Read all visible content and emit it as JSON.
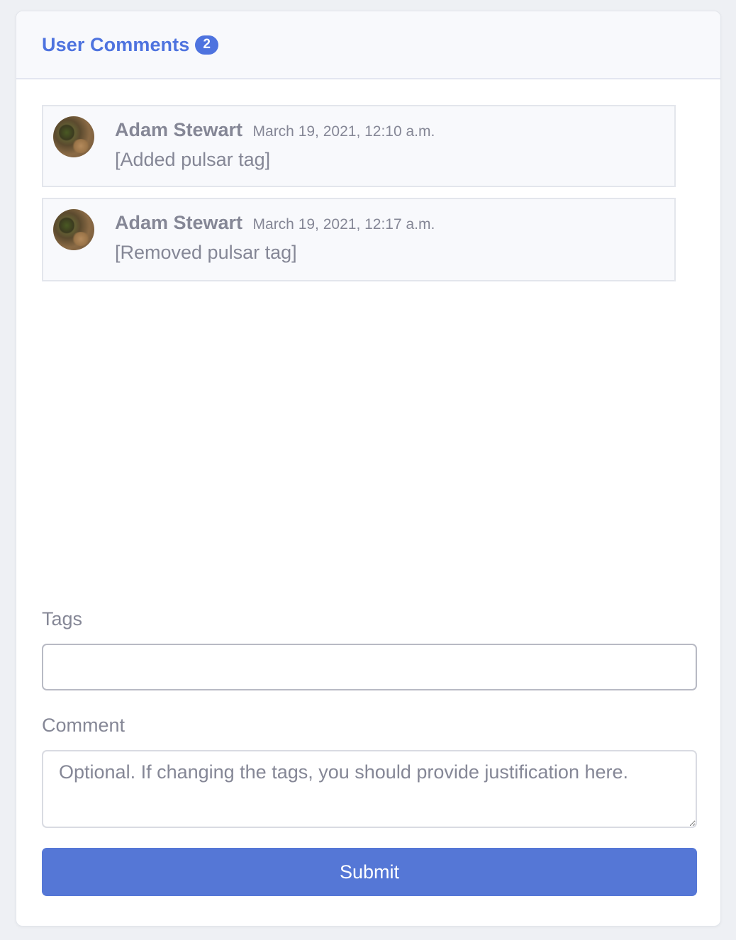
{
  "header": {
    "title": "User Comments",
    "count": "2"
  },
  "comments": [
    {
      "author": "Adam Stewart",
      "timestamp": "March 19, 2021, 12:10 a.m.",
      "text": "[Added pulsar tag]"
    },
    {
      "author": "Adam Stewart",
      "timestamp": "March 19, 2021, 12:17 a.m.",
      "text": "[Removed pulsar tag]"
    }
  ],
  "form": {
    "tags_label": "Tags",
    "tags_value": "",
    "comment_label": "Comment",
    "comment_placeholder": "Optional. If changing the tags, you should provide justification here.",
    "submit_label": "Submit"
  },
  "colors": {
    "accent": "#4e73df",
    "button": "#5577d6",
    "muted_text": "#858796"
  }
}
